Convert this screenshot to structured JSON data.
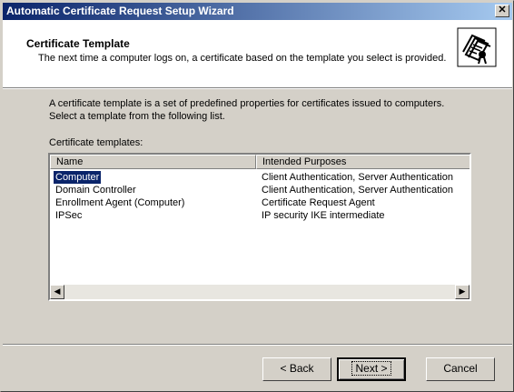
{
  "window": {
    "title": "Automatic Certificate Request Setup Wizard",
    "close_glyph": "✕"
  },
  "header": {
    "title": "Certificate Template",
    "description": "The next time a computer logs on, a certificate based on the template you select is provided.",
    "icon": "certificate-wizard-icon"
  },
  "body": {
    "intro": "A certificate template is a set of predefined properties for certificates issued to computers. Select a template from the following list.",
    "list_label": "Certificate templates:"
  },
  "list": {
    "columns": [
      "Name",
      "Intended Purposes"
    ],
    "rows": [
      {
        "name": "Computer",
        "purposes": "Client Authentication, Server Authentication",
        "selected": true
      },
      {
        "name": "Domain Controller",
        "purposes": "Client Authentication, Server Authentication",
        "selected": false
      },
      {
        "name": "Enrollment Agent (Computer)",
        "purposes": "Certificate Request Agent",
        "selected": false
      },
      {
        "name": "IPSec",
        "purposes": "IP security IKE intermediate",
        "selected": false
      }
    ],
    "scroll_left": "◀",
    "scroll_right": "▶"
  },
  "buttons": {
    "back": "< Back",
    "next": "Next >",
    "cancel": "Cancel"
  },
  "colors": {
    "title_start": "#0a246a",
    "title_end": "#a6caf0",
    "selection": "#0a246a",
    "face": "#d4d0c8"
  }
}
